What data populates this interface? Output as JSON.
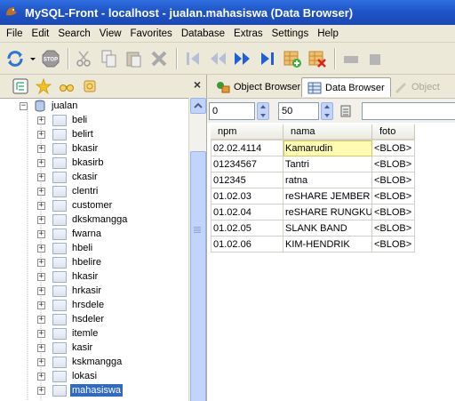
{
  "window": {
    "title": "MySQL-Front - localhost - jualan.mahasiswa  (Data Browser)"
  },
  "menu": [
    "File",
    "Edit",
    "Search",
    "View",
    "Favorites",
    "Database",
    "Extras",
    "Settings",
    "Help"
  ],
  "toolbar_icons": [
    "refresh-icon",
    "dropdown-arrow-icon",
    "stop-icon",
    "cut-icon",
    "copy-icon",
    "paste-icon",
    "delete-icon",
    "first-record-icon",
    "prior-record-icon",
    "next-record-icon",
    "last-record-icon",
    "insert-record-icon",
    "delete-record-icon",
    "post-icon",
    "cancel-icon"
  ],
  "stop_label": "STOP",
  "sidebar": {
    "close_label": "×",
    "database": "jualan",
    "tables": [
      "beli",
      "belirt",
      "bkasir",
      "bkasirb",
      "ckasir",
      "clentri",
      "customer",
      "dkskmangga",
      "fwarna",
      "hbeli",
      "hbelire",
      "hkasir",
      "hrkasir",
      "hrsdele",
      "hsdeler",
      "itemle",
      "kasir",
      "kskmangga",
      "lokasi",
      "mahasiswa"
    ],
    "selected_table": "mahasiswa"
  },
  "tabs": {
    "object_browser": "Object Browser",
    "data_browser": "Data Browser",
    "object_ide": "Object"
  },
  "navigation": {
    "offset": "0",
    "limit": "50"
  },
  "grid": {
    "columns": [
      "npm",
      "nama",
      "foto"
    ],
    "rows": [
      [
        "02.02.4114",
        "Kamarudin",
        "<BLOB>"
      ],
      [
        "01234567",
        "Tantri",
        "<BLOB>"
      ],
      [
        "012345",
        "ratna",
        "<BLOB>"
      ],
      [
        "01.02.03",
        "reSHARE JEMBER",
        "<BLOB>"
      ],
      [
        "01.02.04",
        "reSHARE RUNGKU",
        "<BLOB>"
      ],
      [
        "01.02.05",
        "SLANK BAND",
        "<BLOB>"
      ],
      [
        "01.02.06",
        "KIM-HENDRIK",
        "<BLOB>"
      ]
    ],
    "focused_cell": "Kamarudin"
  },
  "colors": {
    "titlebar": "#1f55c7",
    "selection": "#316ac5",
    "focus_cell": "#fffbb3",
    "chrome": "#ece9d8"
  }
}
